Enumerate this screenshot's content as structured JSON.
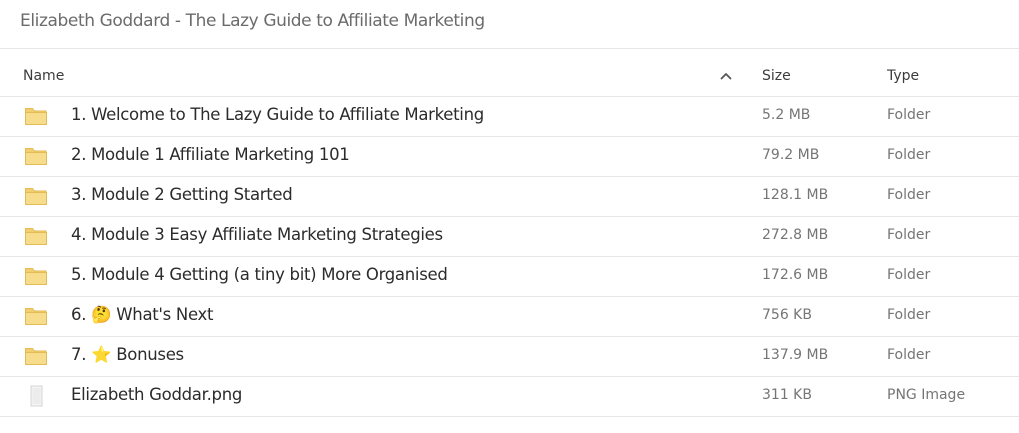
{
  "window": {
    "title": "Elizabeth Goddard - The Lazy Guide to Affiliate Marketing"
  },
  "columns": {
    "name": "Name",
    "size": "Size",
    "type": "Type",
    "sort_icon": "chevron-up-icon"
  },
  "colors": {
    "folder_body": "#f7dc8c",
    "folder_tab": "#f2cf6e",
    "folder_outline": "#e2bb55"
  },
  "items": [
    {
      "name": "1. Welcome to The Lazy Guide to Affiliate Marketing",
      "size": "5.2 MB",
      "type": "Folder",
      "icon": "folder-icon"
    },
    {
      "name": "2. Module 1 Affiliate Marketing 101",
      "size": "79.2 MB",
      "type": "Folder",
      "icon": "folder-icon"
    },
    {
      "name": "3. Module 2 Getting Started",
      "size": "128.1 MB",
      "type": "Folder",
      "icon": "folder-icon"
    },
    {
      "name": "4. Module 3 Easy Affiliate Marketing Strategies",
      "size": "272.8 MB",
      "type": "Folder",
      "icon": "folder-icon"
    },
    {
      "name": "5. Module 4 Getting (a tiny bit) More Organised",
      "size": "172.6 MB",
      "type": "Folder",
      "icon": "folder-icon"
    },
    {
      "name": "6. 🤔 What's Next",
      "size": "756 KB",
      "type": "Folder",
      "icon": "folder-icon"
    },
    {
      "name": "7. ⭐ Bonuses",
      "size": "137.9 MB",
      "type": "Folder",
      "icon": "folder-icon"
    },
    {
      "name": "Elizabeth Goddar.png",
      "size": "311 KB",
      "type": "PNG Image",
      "icon": "image-file-icon"
    }
  ]
}
